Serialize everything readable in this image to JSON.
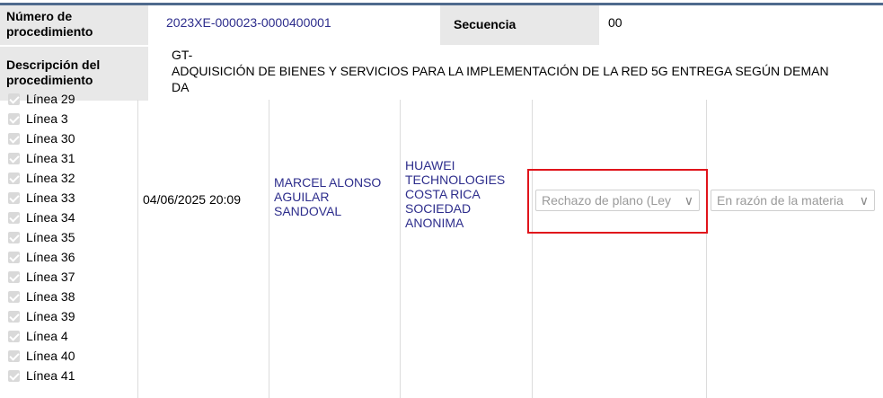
{
  "header": {
    "proc_number_label": "Número de procedimiento",
    "proc_number_value": "2023XE-000023-0000400001",
    "sequence_label": "Secuencia",
    "sequence_value": "00",
    "description_label": "Descripción del procedimiento",
    "description_value": "GT-\nADQUISICIÓN DE BIENES Y SERVICIOS PARA LA IMPLEMENTACIÓN DE LA RED 5G ENTREGA SEGÚN DEMAN\nDA"
  },
  "lines": [
    "Línea 29",
    "Línea 3",
    "Línea 30",
    "Línea 31",
    "Línea 32",
    "Línea 33",
    "Línea 34",
    "Línea 35",
    "Línea 36",
    "Línea 37",
    "Línea 38",
    "Línea 39",
    "Línea 4",
    "Línea 40",
    "Línea 41"
  ],
  "row": {
    "date": "04/06/2025 20:09",
    "person": "MARCEL ALONSO\nAGUILAR\nSANDOVAL",
    "company": "HUAWEI\nTECHNOLOGIES\nCOSTA RICA\nSOCIEDAD\nANONIMA",
    "select1": "Rechazo de plano (Ley",
    "select2": "En razón de la materia"
  },
  "colors": {
    "highlight": "#e0141b",
    "link": "#2d2d8c"
  }
}
